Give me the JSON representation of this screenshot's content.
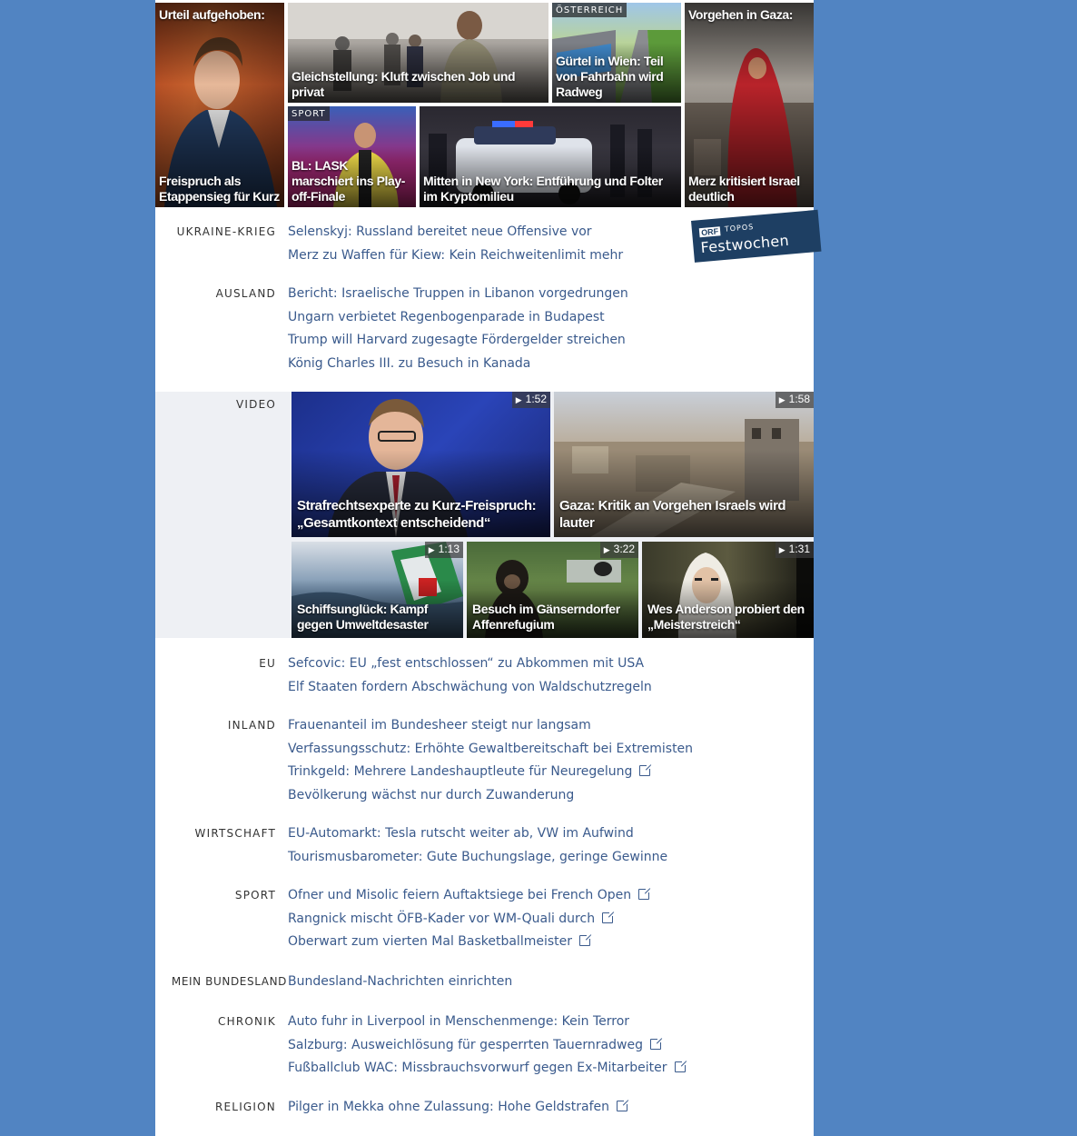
{
  "top_tiles": [
    {
      "caption_top": "Urteil aufgehoben:",
      "caption": "Freispruch als Etappensieg für Kurz"
    },
    {
      "caption": "Gleichstellung: Kluft zwischen Job und privat"
    },
    {
      "kicker": "ÖSTERREICH",
      "caption": "Gürtel in Wien: Teil von Fahrbahn wird Radweg"
    },
    {
      "caption_top": "Vorgehen in Gaza:",
      "caption": "Merz kritisiert Israel deutlich"
    },
    {
      "kicker": "SPORT",
      "caption": "BL: LASK marschiert ins Play-off-Finale"
    },
    {
      "caption": "Mitten in New York: Entführung und Folter im Kryptomilieu"
    }
  ],
  "badge": {
    "orf": "ORF",
    "topos": "TOPOS",
    "title": "Festwochen"
  },
  "sections": {
    "ukraine": {
      "label": "UKRAINE-KRIEG",
      "links": [
        "Selenskyj: Russland bereitet neue Offensive vor",
        "Merz zu Waffen für Kiew: Kein Reichweitenlimit mehr"
      ]
    },
    "ausland": {
      "label": "AUSLAND",
      "links": [
        "Bericht: Israelische Truppen in Libanon vorgedrungen",
        "Ungarn verbietet Regenbogenparade in Budapest",
        "Trump will Harvard zugesagte Fördergelder streichen",
        "König Charles III. zu Besuch in Kanada"
      ]
    },
    "video": {
      "label": "VIDEO",
      "items": [
        {
          "duration": "1:52",
          "caption": "Strafrechtsexperte zu Kurz-Freispruch: „Gesamtkontext entscheidend“"
        },
        {
          "duration": "1:58",
          "caption": "Gaza: Kritik an Vorgehen Israels wird lauter"
        },
        {
          "duration": "1:13",
          "caption": "Schiffsunglück: Kampf gegen Umweltdesaster"
        },
        {
          "duration": "3:22",
          "caption": "Besuch im Gänserndorfer Affenrefugium"
        },
        {
          "duration": "1:31",
          "caption": "Wes Anderson probiert den „Meisterstreich“"
        }
      ]
    },
    "eu": {
      "label": "EU",
      "links": [
        "Sefcovic: EU „fest entschlossen“ zu Abkommen mit USA",
        "Elf Staaten fordern Abschwächung von Waldschutzregeln"
      ]
    },
    "inland": {
      "label": "INLAND",
      "links": [
        "Frauenanteil im Bundesheer steigt nur langsam",
        "Verfassungsschutz: Erhöhte Gewaltbereitschaft bei Extremisten",
        "Trinkgeld: Mehrere Landeshauptleute für Neuregelung",
        "Bevölkerung wächst nur durch Zuwanderung"
      ]
    },
    "wirtschaft": {
      "label": "WIRTSCHAFT",
      "links": [
        "EU-Automarkt: Tesla rutscht weiter ab, VW im Aufwind",
        "Tourismusbarometer: Gute Buchungslage, geringe Gewinne"
      ]
    },
    "sport": {
      "label": "SPORT",
      "links": [
        "Ofner und Misolic feiern Auftaktsiege bei French Open",
        "Rangnick mischt ÖFB-Kader vor WM-Quali durch",
        "Oberwart zum vierten Mal Basketballmeister"
      ]
    },
    "bundesland": {
      "label": "MEIN BUNDESLAND",
      "links": [
        "Bundesland-Nachrichten einrichten"
      ]
    },
    "chronik": {
      "label": "CHRONIK",
      "links": [
        "Auto fuhr in Liverpool in Menschenmenge: Kein Terror",
        "Salzburg: Ausweichlösung für gesperrten Tauernradweg",
        "Fußballclub WAC: Missbrauchsvorwurf gegen Ex-Mitarbeiter"
      ]
    },
    "religion": {
      "label": "RELIGION",
      "links": [
        "Pilger in Mekka ohne Zulassung: Hohe Geldstrafen"
      ]
    }
  },
  "colors": {
    "page_bg": "#5184c2",
    "link": "#3a5a8c",
    "badge": "#1e3f63"
  }
}
